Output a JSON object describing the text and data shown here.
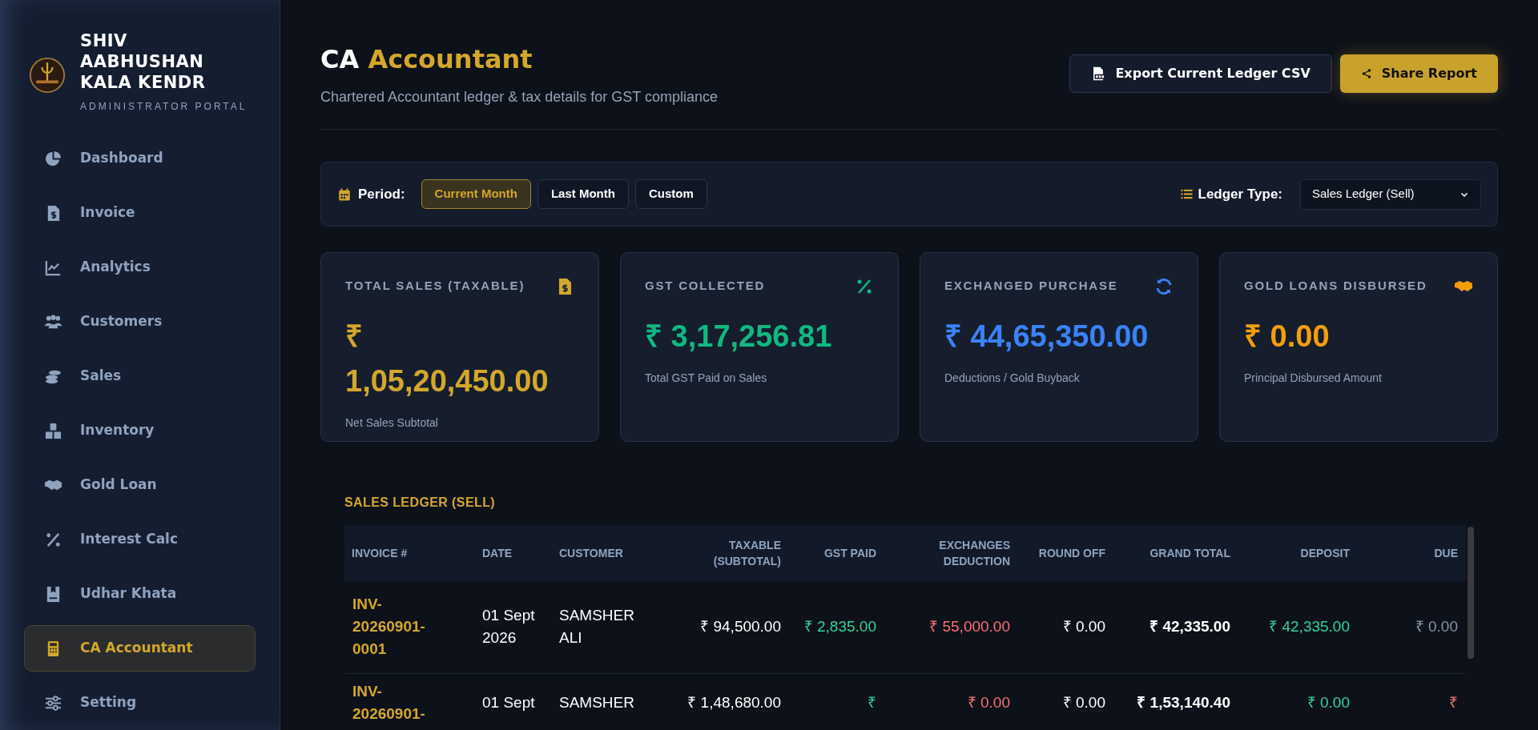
{
  "sidebar": {
    "brand": {
      "name": "SHIV AABHUSHAN KALA KENDR",
      "subtitle": "ADMINISTRATOR PORTAL"
    },
    "items": [
      {
        "label": "Dashboard",
        "selected": false
      },
      {
        "label": "Invoice",
        "selected": false
      },
      {
        "label": "Analytics",
        "selected": false
      },
      {
        "label": "Customers",
        "selected": false
      },
      {
        "label": "Sales",
        "selected": false
      },
      {
        "label": "Inventory",
        "selected": false
      },
      {
        "label": "Gold Loan",
        "selected": false
      },
      {
        "label": "Interest Calc",
        "selected": false
      },
      {
        "label": "Udhar Khata",
        "selected": false
      },
      {
        "label": "CA Accountant",
        "selected": true
      },
      {
        "label": "Setting",
        "selected": false
      }
    ]
  },
  "header": {
    "title": "CA",
    "title_highlight": "Accountant",
    "subtitle": "Chartered Accountant ledger & tax details for GST compliance",
    "buttons": [
      {
        "label": "Export Current Ledger CSV",
        "kind": "secondary"
      },
      {
        "label": "Share Report",
        "kind": "primary"
      }
    ]
  },
  "filters": {
    "period_label": "Period:",
    "periods": [
      {
        "label": "Current Month",
        "selected": true
      },
      {
        "label": "Last Month",
        "selected": false
      },
      {
        "label": "Custom",
        "selected": false
      }
    ],
    "ledger_type_label": "Ledger Type:",
    "ledger_type_value": "Sales Ledger (Sell)"
  },
  "cards": [
    {
      "title": "TOTAL SALES (TAXABLE)",
      "value": "₹ 1,05,20,450.00",
      "caption": "Net Sales Subtotal",
      "color": "#d4a72c"
    },
    {
      "title": "GST COLLECTED",
      "value": "₹ 3,17,256.81",
      "caption": "Total GST Paid on Sales",
      "color": "#10b981"
    },
    {
      "title": "EXCHANGED PURCHASE",
      "value": "₹ 44,65,350.00",
      "caption": "Deductions / Gold Buyback",
      "color": "#3b82f6"
    },
    {
      "title": "GOLD LOANS DISBURSED",
      "value": "₹ 0.00",
      "caption": "Principal Disbursed Amount",
      "color": "#f59e0b"
    }
  ],
  "ledger": {
    "title": "SALES LEDGER (SELL)",
    "columns": [
      "INVOICE #",
      "DATE",
      "CUSTOMER",
      "TAXABLE (SUBTOTAL)",
      "GST PAID",
      "EXCHANGES DEDUCTION",
      "ROUND OFF",
      "GRAND TOTAL",
      "DEPOSIT",
      "DUE"
    ],
    "rows": [
      {
        "invoice": "INV-20260901-0001",
        "date": "01 Sept 2026",
        "customer": "SAMSHER ALI",
        "taxable": "₹ 94,500.00",
        "gst": "₹ 2,835.00",
        "exchange": "₹ 55,000.00",
        "round_off": "₹ 0.00",
        "grand_total": "₹ 42,335.00",
        "deposit": "₹ 42,335.00",
        "due": "₹ 0.00",
        "due_pending": false
      },
      {
        "invoice": "INV-20260901-",
        "date": "01 Sept",
        "customer": "SAMSHER",
        "taxable": "₹ 1,48,680.00",
        "gst": "₹",
        "exchange": "₹ 0.00",
        "round_off": "₹ 0.00",
        "grand_total": "₹ 1,53,140.40",
        "deposit": "₹ 0.00",
        "due": "₹",
        "due_pending": true
      }
    ]
  }
}
